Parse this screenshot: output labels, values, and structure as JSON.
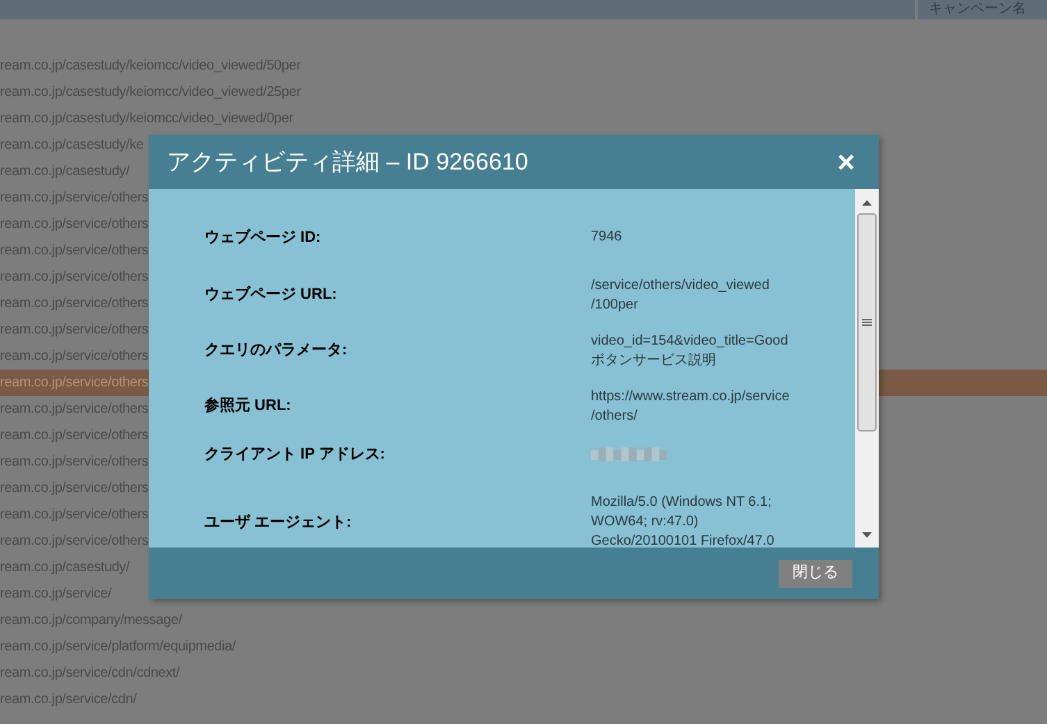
{
  "table": {
    "header": {
      "column_2": "キャンペーン名"
    },
    "rows": [
      {
        "text": "ream.co.jp/casestudy/keiomcc/video_viewed/50per",
        "selected": false
      },
      {
        "text": "ream.co.jp/casestudy/keiomcc/video_viewed/25per",
        "selected": false
      },
      {
        "text": "ream.co.jp/casestudy/keiomcc/video_viewed/0per",
        "selected": false
      },
      {
        "text": "ream.co.jp/casestudy/ke",
        "selected": false
      },
      {
        "text": "ream.co.jp/casestudy/",
        "selected": false
      },
      {
        "text": "ream.co.jp/service/others",
        "selected": false
      },
      {
        "text": "ream.co.jp/service/others",
        "selected": false
      },
      {
        "text": "ream.co.jp/service/others",
        "selected": false
      },
      {
        "text": "ream.co.jp/service/others",
        "selected": false
      },
      {
        "text": "ream.co.jp/service/others",
        "selected": false
      },
      {
        "text": "ream.co.jp/service/others",
        "selected": false
      },
      {
        "text": "ream.co.jp/service/others",
        "selected": false
      },
      {
        "text": "ream.co.jp/service/others",
        "selected": true
      },
      {
        "text": "ream.co.jp/service/others",
        "selected": false
      },
      {
        "text": "ream.co.jp/service/others",
        "selected": false
      },
      {
        "text": "ream.co.jp/service/others",
        "selected": false
      },
      {
        "text": "ream.co.jp/service/others",
        "selected": false
      },
      {
        "text": "ream.co.jp/service/others",
        "selected": false
      },
      {
        "text": "ream.co.jp/service/others",
        "selected": false
      },
      {
        "text": "ream.co.jp/casestudy/",
        "selected": false
      },
      {
        "text": "ream.co.jp/service/",
        "selected": false
      },
      {
        "text": "ream.co.jp/company/message/",
        "selected": false
      },
      {
        "text": "ream.co.jp/service/platform/equipmedia/",
        "selected": false
      },
      {
        "text": "ream.co.jp/service/cdn/cdnext/",
        "selected": false
      },
      {
        "text": "ream.co.jp/service/cdn/",
        "selected": false
      }
    ]
  },
  "dialog": {
    "title": "アクティビティ詳細 – ID 9266610",
    "close": "×",
    "fields": [
      {
        "label": "ウェブページ ID:",
        "kind": "text",
        "value": [
          "7946"
        ]
      },
      {
        "label": "ウェブページ URL:",
        "kind": "text",
        "value": [
          "/service/others/video_viewed",
          "/100per"
        ]
      },
      {
        "label": "クエリのパラメータ:",
        "kind": "text",
        "value": [
          "video_id=154&video_title=Good",
          "ボタンサービス説明"
        ]
      },
      {
        "label": "参照元 URL:",
        "kind": "text",
        "value": [
          "https://www.stream.co.jp/service",
          "/others/"
        ]
      },
      {
        "label": "クライアント IP アドレス:",
        "kind": "redacted"
      },
      {
        "label": "ユーザ エージェント:",
        "kind": "text",
        "value": [
          "Mozilla/5.0 (Windows NT 6.1;",
          "WOW64; rv:47.0)",
          "Gecko/20100101 Firefox/47.0"
        ]
      }
    ],
    "button": "閉じる"
  }
}
